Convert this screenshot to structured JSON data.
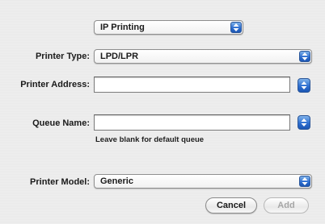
{
  "connection_popup": {
    "value": "IP Printing",
    "icon": "popup-arrows-icon"
  },
  "printer_type": {
    "label": "Printer Type:",
    "value": "LPD/LPR",
    "icon": "popup-arrows-icon"
  },
  "printer_address": {
    "label": "Printer Address:",
    "value": "",
    "placeholder": "",
    "history_icon": "history-popup-icon"
  },
  "queue_name": {
    "label": "Queue Name:",
    "value": "",
    "placeholder": "",
    "hint": "Leave blank for default queue",
    "history_icon": "history-popup-icon"
  },
  "printer_model": {
    "label": "Printer Model:",
    "value": "Generic",
    "icon": "popup-arrows-icon"
  },
  "buttons": {
    "cancel": "Cancel",
    "add": "Add"
  },
  "colors": {
    "accent": "#2e6fd1"
  }
}
